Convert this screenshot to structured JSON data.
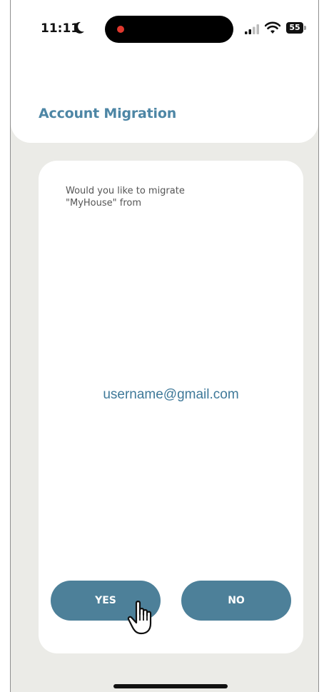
{
  "status_bar": {
    "time": "11:11",
    "battery": "55",
    "moon_icon": "moon-icon",
    "signal_icon": "cellular-signal-icon",
    "wifi_icon": "wifi-icon",
    "battery_icon": "battery-icon",
    "recording_color": "#e0382e"
  },
  "header": {
    "title": "Account Migration"
  },
  "card": {
    "prompt": "Would you like to migrate\n\"MyHouse\" from",
    "email": "username@gmail.com"
  },
  "buttons": {
    "yes_label": "YES",
    "no_label": "NO"
  },
  "colors": {
    "accent": "#4d86a5",
    "button": "#4d8099",
    "background": "#ebebe7"
  },
  "pointer_icon": "hand-pointer-icon"
}
